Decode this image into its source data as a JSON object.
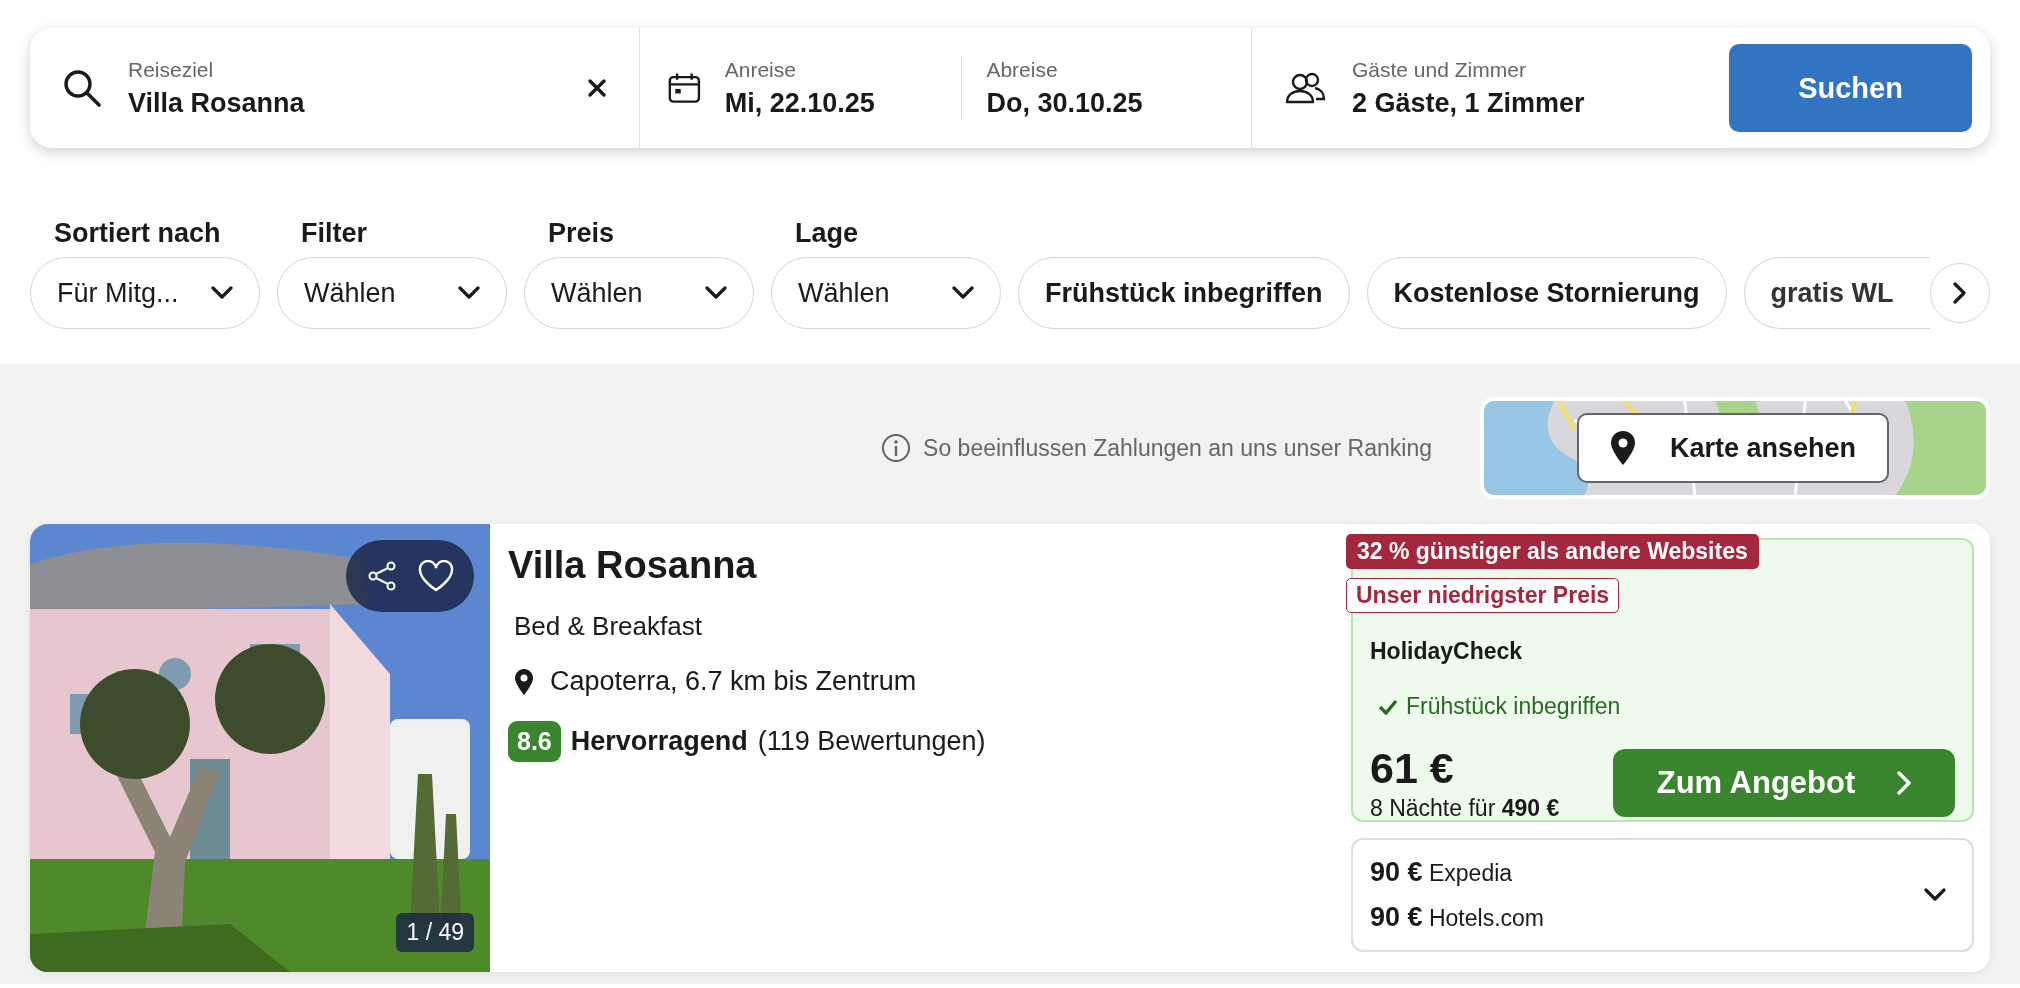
{
  "search": {
    "destination": {
      "label": "Reiseziel",
      "value": "Villa Rosanna"
    },
    "checkin": {
      "label": "Anreise",
      "value": "Mi, 22.10.25"
    },
    "checkout": {
      "label": "Abreise",
      "value": "Do, 30.10.25"
    },
    "guests": {
      "label": "Gäste und Zimmer",
      "value": "2 Gäste, 1 Zimmer"
    },
    "button": "Suchen"
  },
  "filters": {
    "dropdowns": [
      {
        "label": "Sortiert nach",
        "value": "Für Mitg..."
      },
      {
        "label": "Filter",
        "value": "Wählen"
      },
      {
        "label": "Preis",
        "value": "Wählen"
      },
      {
        "label": "Lage",
        "value": "Wählen"
      }
    ],
    "chips": [
      "Frühstück inbegriffen",
      "Kostenlose Stornierung",
      "gratis WL"
    ]
  },
  "ranking_note": "So beeinflussen Zahlungen an uns unser Ranking",
  "map_button": "Karte ansehen",
  "result": {
    "photo_counter": "1 / 49",
    "title": "Villa Rosanna",
    "type": "Bed & Breakfast",
    "location": "Capoterra, 6.7 km bis Zentrum",
    "rating": {
      "score": "8.6",
      "verdict": "Hervorragend",
      "count": "(119 Bewertungen)"
    },
    "deal": {
      "discount_badge": "32 % günstiger als andere Websites",
      "lowest_badge": "Unser niedrigster Preis",
      "provider": "HolidayCheck",
      "perk": "Frühstück inbegriffen",
      "price": "61 €",
      "total": "8 Nächte für **490 €**",
      "button": "Zum Angebot"
    },
    "other_offers": [
      "**90 €** Expedia",
      "**90 €** Hotels.com"
    ]
  }
}
